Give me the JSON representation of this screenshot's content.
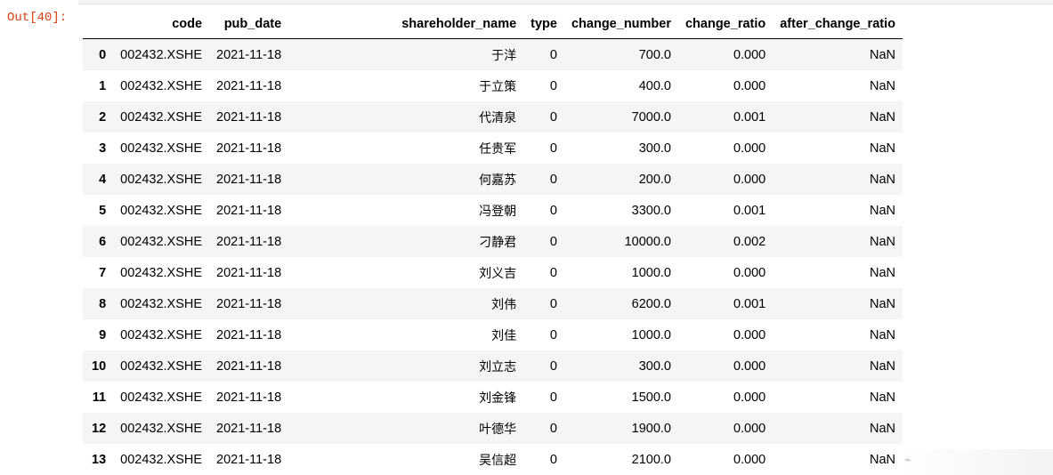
{
  "out_prompt": "Out[40]:",
  "columns": [
    "code",
    "pub_date",
    "shareholder_name",
    "type",
    "change_number",
    "change_ratio",
    "after_change_ratio"
  ],
  "rows": [
    {
      "idx": "0",
      "code": "002432.XSHE",
      "pub_date": "2021-11-18",
      "shareholder_name": "于洋",
      "type": "0",
      "change_number": "700.0",
      "change_ratio": "0.000",
      "after_change_ratio": "NaN"
    },
    {
      "idx": "1",
      "code": "002432.XSHE",
      "pub_date": "2021-11-18",
      "shareholder_name": "于立策",
      "type": "0",
      "change_number": "400.0",
      "change_ratio": "0.000",
      "after_change_ratio": "NaN"
    },
    {
      "idx": "2",
      "code": "002432.XSHE",
      "pub_date": "2021-11-18",
      "shareholder_name": "代清泉",
      "type": "0",
      "change_number": "7000.0",
      "change_ratio": "0.001",
      "after_change_ratio": "NaN"
    },
    {
      "idx": "3",
      "code": "002432.XSHE",
      "pub_date": "2021-11-18",
      "shareholder_name": "任贵军",
      "type": "0",
      "change_number": "300.0",
      "change_ratio": "0.000",
      "after_change_ratio": "NaN"
    },
    {
      "idx": "4",
      "code": "002432.XSHE",
      "pub_date": "2021-11-18",
      "shareholder_name": "何嘉苏",
      "type": "0",
      "change_number": "200.0",
      "change_ratio": "0.000",
      "after_change_ratio": "NaN"
    },
    {
      "idx": "5",
      "code": "002432.XSHE",
      "pub_date": "2021-11-18",
      "shareholder_name": "冯登朝",
      "type": "0",
      "change_number": "3300.0",
      "change_ratio": "0.001",
      "after_change_ratio": "NaN"
    },
    {
      "idx": "6",
      "code": "002432.XSHE",
      "pub_date": "2021-11-18",
      "shareholder_name": "刁静君",
      "type": "0",
      "change_number": "10000.0",
      "change_ratio": "0.002",
      "after_change_ratio": "NaN"
    },
    {
      "idx": "7",
      "code": "002432.XSHE",
      "pub_date": "2021-11-18",
      "shareholder_name": "刘义吉",
      "type": "0",
      "change_number": "1000.0",
      "change_ratio": "0.000",
      "after_change_ratio": "NaN"
    },
    {
      "idx": "8",
      "code": "002432.XSHE",
      "pub_date": "2021-11-18",
      "shareholder_name": "刘伟",
      "type": "0",
      "change_number": "6200.0",
      "change_ratio": "0.001",
      "after_change_ratio": "NaN"
    },
    {
      "idx": "9",
      "code": "002432.XSHE",
      "pub_date": "2021-11-18",
      "shareholder_name": "刘佳",
      "type": "0",
      "change_number": "1000.0",
      "change_ratio": "0.000",
      "after_change_ratio": "NaN"
    },
    {
      "idx": "10",
      "code": "002432.XSHE",
      "pub_date": "2021-11-18",
      "shareholder_name": "刘立志",
      "type": "0",
      "change_number": "300.0",
      "change_ratio": "0.000",
      "after_change_ratio": "NaN"
    },
    {
      "idx": "11",
      "code": "002432.XSHE",
      "pub_date": "2021-11-18",
      "shareholder_name": "刘金锋",
      "type": "0",
      "change_number": "1500.0",
      "change_ratio": "0.000",
      "after_change_ratio": "NaN"
    },
    {
      "idx": "12",
      "code": "002432.XSHE",
      "pub_date": "2021-11-18",
      "shareholder_name": "叶德华",
      "type": "0",
      "change_number": "1900.0",
      "change_ratio": "0.000",
      "after_change_ratio": "NaN"
    },
    {
      "idx": "13",
      "code": "002432.XSHE",
      "pub_date": "2021-11-18",
      "shareholder_name": "吴信超",
      "type": "0",
      "change_number": "2100.0",
      "change_ratio": "0.000",
      "after_change_ratio": "NaN"
    }
  ],
  "watermark": {
    "icon": "watermark-logo-icon",
    "color": "#b8b8b8"
  }
}
